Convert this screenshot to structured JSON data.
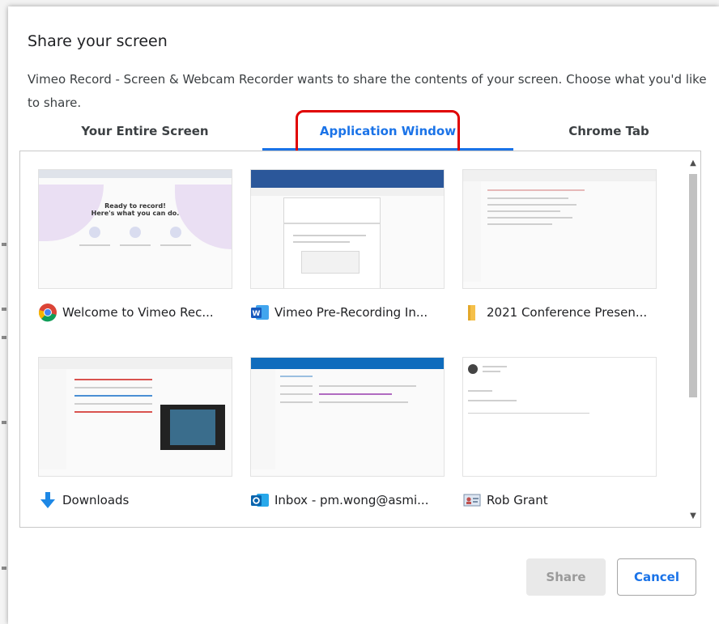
{
  "dialog": {
    "title": "Share your screen",
    "description": "Vimeo Record - Screen & Webcam Recorder wants to share the contents of your screen. Choose what you'd like to share."
  },
  "tabs": [
    {
      "label": "Your Entire Screen",
      "active": false
    },
    {
      "label": "Application Window",
      "active": true
    },
    {
      "label": "Chrome Tab",
      "active": false
    }
  ],
  "windows": [
    {
      "label": "Welcome to Vimeo Rec...",
      "icon": "chrome-icon",
      "thumb_text": "Ready to record!\nHere's what you can do."
    },
    {
      "label": "Vimeo Pre-Recording In...",
      "icon": "word-icon"
    },
    {
      "label": "2021 Conference Presen...",
      "icon": "folder-icon"
    },
    {
      "label": "Downloads",
      "icon": "download-arrow-icon"
    },
    {
      "label": "Inbox - pm.wong@asmi...",
      "icon": "outlook-icon"
    },
    {
      "label": "Rob Grant",
      "icon": "contact-card-icon"
    }
  ],
  "buttons": {
    "share": "Share",
    "cancel": "Cancel"
  },
  "colors": {
    "accent": "#1a73e8",
    "highlight": "#e00000"
  }
}
